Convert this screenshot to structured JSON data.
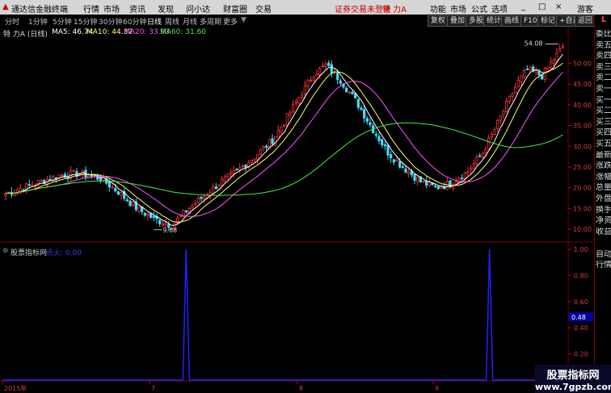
{
  "window": {
    "app_title": "通达信金融终端",
    "menu": [
      "行情",
      "市场",
      "资讯",
      "发现",
      "问小达",
      "财富圈",
      "交易"
    ],
    "notice": "证券交易未登录",
    "stock_tag": "特 力A",
    "right_menu": [
      "功能",
      "市场",
      "公式",
      "选项"
    ],
    "user": "游客",
    "controls": [
      "_",
      "□",
      "×"
    ]
  },
  "toolbar": {
    "periods": [
      "分时",
      "1分钟",
      "5分钟",
      "15分钟",
      "30分钟",
      "60分钟",
      "日线",
      "周线",
      "月线",
      "多周期",
      "更多"
    ],
    "active_period": "日线",
    "buttons": [
      "复权",
      "叠加",
      "多股",
      "统计",
      "画线",
      "F10",
      "标记",
      "+自选",
      "返回"
    ]
  },
  "main_chart": {
    "stock_label": "特 力A (日线)",
    "ma": [
      {
        "label": "MA5: 46.74",
        "color": "#ffffff"
      },
      {
        "label": "MA10: 44.32",
        "color": "#ffff66"
      },
      {
        "label": "MA20: 33.93",
        "color": "#ff55ff"
      },
      {
        "label": "MA60: 31.60",
        "color": "#44ee44"
      }
    ],
    "y_ticks": [
      "50.00",
      "45.00",
      "40.00",
      "35.00",
      "30.00",
      "25.00",
      "20.00",
      "15.00",
      "10.00"
    ],
    "y_range": [
      7.5,
      56.5
    ],
    "high_label": "54.08",
    "low_label": "9.88"
  },
  "indicator": {
    "name": "股票指标网",
    "value_label": "点火: 0.00",
    "y_ticks": [
      "1.00",
      "0.80",
      "0.60",
      "0.40",
      "0.20"
    ],
    "current_value": "0.48",
    "x_labels": [
      "2015年",
      "7",
      "8",
      "9"
    ]
  },
  "right_panel": {
    "items": [
      "委比",
      "卖五",
      "卖四",
      "卖三",
      "卖二",
      "卖一",
      "买一",
      "买二",
      "买三",
      "买四",
      "买五",
      "最新",
      "涨跌",
      "涨幅",
      "总量",
      "外盘",
      "换手",
      "净资",
      "收益"
    ],
    "lower": [
      "自动",
      "行情"
    ],
    "corner": "L"
  },
  "watermark": {
    "title": "股票指标网",
    "url": "www.7gpzb.com"
  },
  "colors": {
    "up": "#ff3333",
    "down": "#44ddff",
    "grid": "#7a0000",
    "indicator_line": "#2222ff"
  }
}
